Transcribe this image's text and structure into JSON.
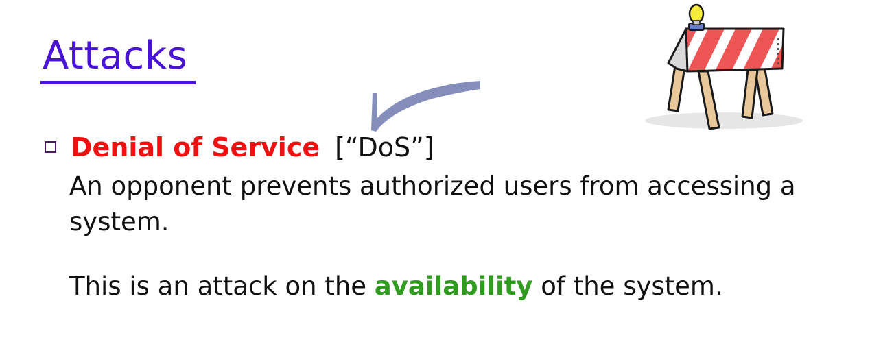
{
  "slide": {
    "title": "Attacks"
  },
  "bullet": {
    "term": "Denial of Service",
    "abbreviation": "[“DoS”]",
    "definition": "An opponent prevents authorized users from accessing a system.",
    "statement_before": "This is an attack on the ",
    "statement_highlight": "availability",
    "statement_after": " of the system."
  },
  "colors": {
    "title": "#4a14d8",
    "term": "#ee1111",
    "highlight": "#2f9b1f",
    "annotation_stroke": "#7b84b4"
  },
  "icons": {
    "barricade": "road-barricade-icon",
    "bullet": "square-bullet-icon",
    "annotation": "checkmark-stroke"
  }
}
